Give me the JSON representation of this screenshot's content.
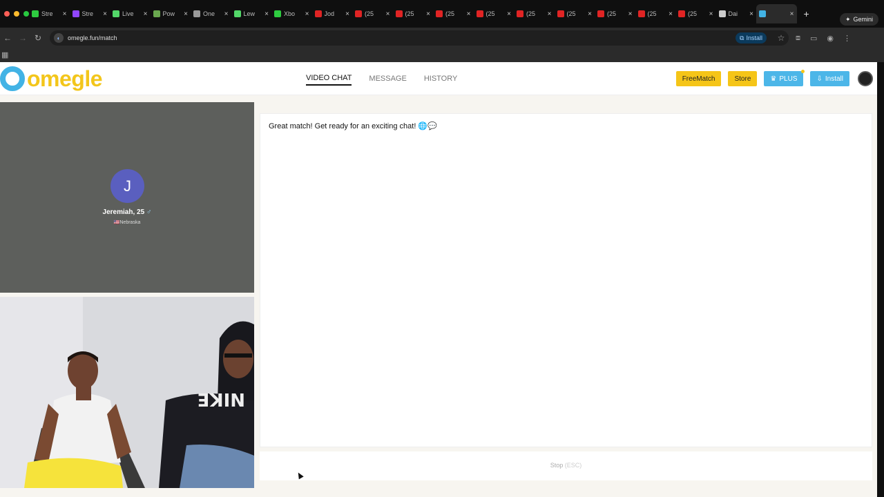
{
  "browser": {
    "tabs": [
      {
        "label": "Stre",
        "fav": "#2ecc40",
        "icon": "kick-icon"
      },
      {
        "label": "Stre",
        "fav": "#9146ff",
        "icon": "twitch-icon"
      },
      {
        "label": "Live",
        "fav": "#53d769",
        "icon": "play-icon"
      },
      {
        "label": "Pow",
        "fav": "#6aa84f",
        "icon": "leaf-icon"
      },
      {
        "label": "One",
        "fav": "#999999",
        "icon": "globe-icon"
      },
      {
        "label": "Lew",
        "fav": "#53d769",
        "icon": "play-icon"
      },
      {
        "label": "Xbo",
        "fav": "#2ecc40",
        "icon": "xbox-icon"
      },
      {
        "label": "Jod",
        "fav": "#e02424",
        "icon": "youtube-icon"
      },
      {
        "label": "(25",
        "fav": "#e02424",
        "icon": "youtube-icon"
      },
      {
        "label": "(25",
        "fav": "#e02424",
        "icon": "youtube-icon"
      },
      {
        "label": "(25",
        "fav": "#e02424",
        "icon": "youtube-icon"
      },
      {
        "label": "(25",
        "fav": "#e02424",
        "icon": "youtube-icon"
      },
      {
        "label": "(25",
        "fav": "#e02424",
        "icon": "youtube-icon"
      },
      {
        "label": "(25",
        "fav": "#e02424",
        "icon": "youtube-icon"
      },
      {
        "label": "(25",
        "fav": "#e02424",
        "icon": "youtube-icon"
      },
      {
        "label": "(25",
        "fav": "#e02424",
        "icon": "youtube-icon"
      },
      {
        "label": "(25",
        "fav": "#e02424",
        "icon": "youtube-icon"
      },
      {
        "label": "Dai",
        "fav": "#cccccc",
        "icon": "x-icon"
      },
      {
        "label": "",
        "fav": "#42b3e5",
        "icon": "omegle-icon",
        "active": true
      }
    ],
    "gemini_label": "Gemini",
    "url": "omegle.fun/match",
    "install_label": "Install"
  },
  "header": {
    "logo_text": "omegle",
    "nav": [
      {
        "label": "VIDEO CHAT",
        "active": true
      },
      {
        "label": "MESSAGE",
        "active": false
      },
      {
        "label": "HISTORY",
        "active": false
      }
    ],
    "buttons": {
      "freematch": "FreeMatch",
      "store": "Store",
      "plus": "PLUS",
      "install": "Install"
    }
  },
  "remote": {
    "initial": "J",
    "name": "Jeremiah, 25",
    "location": "🇺🇸Nebraska",
    "avatar_color": "#5a5fbf"
  },
  "chat": {
    "message": "Great match! Get ready for an exciting chat! 🌐💬"
  },
  "controls": {
    "stop_label": "Stop",
    "stop_hint": "(ESC)"
  }
}
